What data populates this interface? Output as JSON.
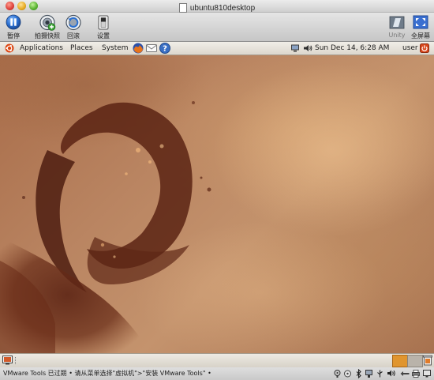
{
  "window": {
    "title": "ubuntu810desktop"
  },
  "toolbar": {
    "pause_label": "暂停",
    "snapshot_label": "拍摄快照",
    "revert_label": "回滚",
    "settings_label": "设置",
    "unity_label": "Unity",
    "fullscreen_label": "全屏幕"
  },
  "panel": {
    "menus": [
      "Applications",
      "Places",
      "System"
    ],
    "clock": "Sun Dec 14,  6:28 AM",
    "user": "user"
  },
  "status": {
    "message": "VMware Tools 已过期 • 请从菜单选择\"虚拟机\">\"安装 VMware Tools\" •"
  },
  "colors": {
    "wallpaper_base": "#b07a56",
    "ubuntu_orange": "#dd4814",
    "pager_active": "#e0952f",
    "pager_inactive": "#b9b3aa"
  }
}
